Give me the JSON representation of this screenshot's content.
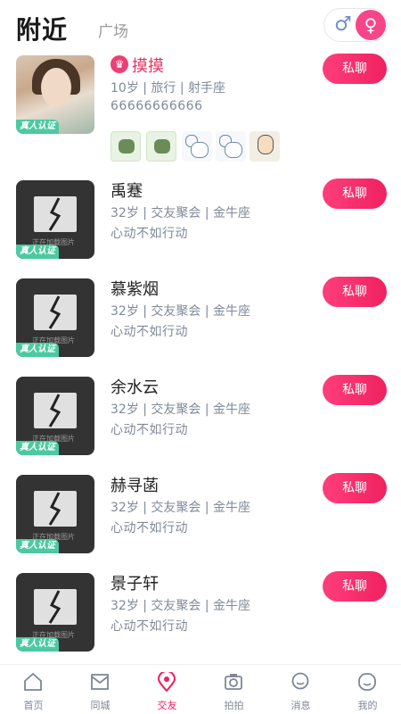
{
  "header": {
    "tab_nearby": "附近",
    "tab_square": "广场",
    "gender_male_symbol": "♂",
    "gender_female_symbol": "♀"
  },
  "colors": {
    "accent": "#f0215f",
    "verified": "#4cc9a0",
    "female": "#f7458a",
    "male": "#6f8fd0"
  },
  "list": {
    "chat_label": "私聊",
    "verified_label": "真人认证",
    "loading_text": "正在加载图片",
    "users": [
      {
        "name": "摸摸",
        "info": "10岁 | 旅行 | 射手座",
        "signature": "66666666666",
        "vip": true,
        "photo": true,
        "stickers": [
          "dog-sticker",
          "dog-sticker",
          "mouse-sticker",
          "mouse-sticker",
          "man-sticker"
        ]
      },
      {
        "name": "禹蹇",
        "info": "32岁 | 交友聚会 | 金牛座",
        "signature": "心动不如行动",
        "vip": false,
        "photo": false
      },
      {
        "name": "慕紫烟",
        "info": "32岁 | 交友聚会 | 金牛座",
        "signature": "心动不如行动",
        "vip": false,
        "photo": false
      },
      {
        "name": "余水云",
        "info": "32岁 | 交友聚会 | 金牛座",
        "signature": "心动不如行动",
        "vip": false,
        "photo": false
      },
      {
        "name": "赫寻菡",
        "info": "32岁 | 交友聚会 | 金牛座",
        "signature": "心动不如行动",
        "vip": false,
        "photo": false
      },
      {
        "name": "景子轩",
        "info": "32岁 | 交友聚会 | 金牛座",
        "signature": "心动不如行动",
        "vip": false,
        "photo": false
      }
    ]
  },
  "navbar": {
    "items": [
      {
        "label": "首页",
        "icon": "home-icon",
        "active": false
      },
      {
        "label": "同城",
        "icon": "envelope-icon",
        "active": false
      },
      {
        "label": "交友",
        "icon": "location-pin-icon",
        "active": true
      },
      {
        "label": "拍拍",
        "icon": "camera-icon",
        "active": false
      },
      {
        "label": "消息",
        "icon": "message-icon",
        "active": false
      },
      {
        "label": "我的",
        "icon": "profile-icon",
        "active": false
      }
    ]
  }
}
